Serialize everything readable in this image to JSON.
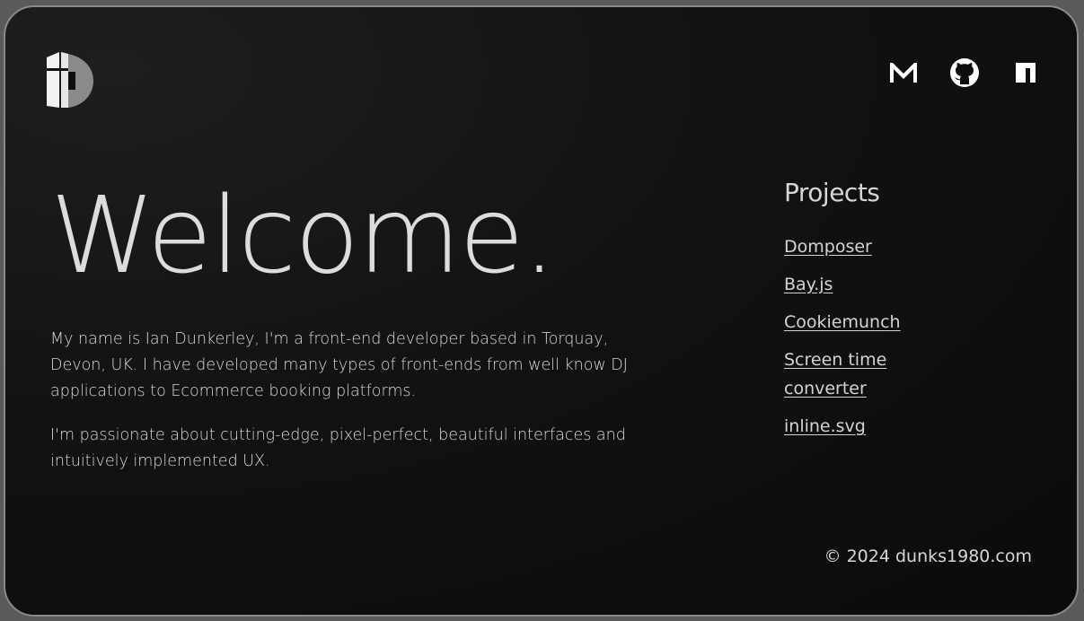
{
  "header": {
    "logo_name": "dunks1980-logo",
    "social": [
      {
        "name": "gmail-icon"
      },
      {
        "name": "github-icon"
      },
      {
        "name": "npm-icon"
      }
    ]
  },
  "main": {
    "title": "Welcome.",
    "paragraphs": [
      "My name is Ian Dunkerley, I'm a front-end developer based in Torquay, Devon, UK. I have developed many types of front-ends from well know DJ applications to Ecommerce booking platforms.",
      "I'm passionate about cutting-edge, pixel-perfect, beautiful interfaces and intuitively implemented UX."
    ]
  },
  "projects": {
    "heading": "Projects",
    "items": [
      {
        "label": "Domposer"
      },
      {
        "label": "Bay.js"
      },
      {
        "label": "Cookiemunch"
      },
      {
        "label": "Screen time converter"
      },
      {
        "label": "inline.svg"
      }
    ]
  },
  "footer": {
    "copyright": "© 2024 dunks1980.com"
  },
  "colors": {
    "background": "#0e0e0e",
    "text": "#d8d8d8",
    "frame": "#5a5a5c"
  }
}
